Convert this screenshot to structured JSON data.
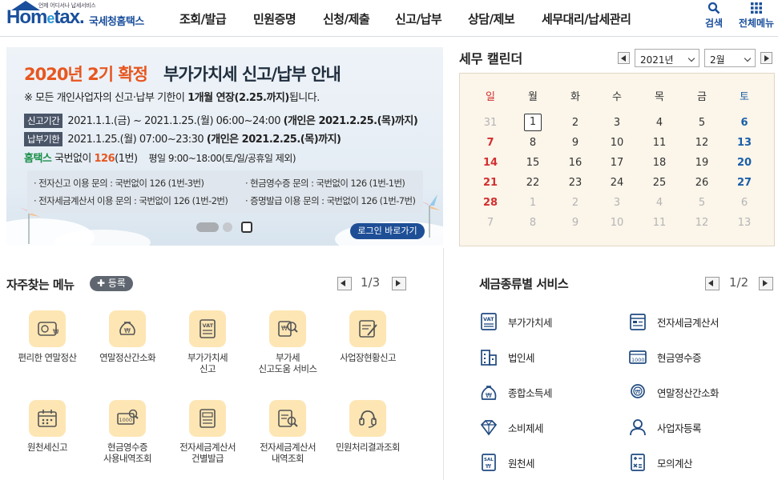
{
  "header": {
    "logo_small": "언제 어디서나 납세서비스",
    "logo_main_a": "Hom",
    "logo_main_e": "e",
    "logo_main_b": "tax.",
    "logo_kr": "국세청홈택스",
    "nav": [
      "조회/발급",
      "민원증명",
      "신청/제출",
      "신고/납부",
      "상담/제보",
      "세무대리/납세관리"
    ],
    "search_label": "검색",
    "all_menu_label": "전체메뉴"
  },
  "banner": {
    "title_highlight": "2020년 2기 확정",
    "title_rest": "부가가치세 신고/납부 안내",
    "note_pre": "※ 모든 개인사업자의 신고·납부 기한이 ",
    "note_bold": "1개월 연장(2.25.까지)",
    "note_post": "됩니다.",
    "row1_tag": "신고기간",
    "row1_text": "2021.1.1.(금) ~ 2021.1.25.(월) 06:00~24:00 ",
    "row1_bold": "(개인은 2021.2.25.(목)까지)",
    "row2_tag": "납부기한",
    "row2_text": "2021.1.25.(월) 07:00~23:30 ",
    "row2_bold": "(개인은 2021.2.25.(목)까지)",
    "hometax_label": "홈택스",
    "hometax_mid": " 국번없이 ",
    "hometax_num": "126",
    "hometax_tail": "(1번)",
    "hours": "평일 9:00~18:00(토/일/공휴일 제외)",
    "info": [
      "· 전자신고 이용 문의 : 국번없이 126 (1번-3번)",
      "· 현금영수증 문의 : 국번없이 126 (1번-1번)",
      "· 전자세금계산서 이용 문의 : 국번없이 126 (1번-2번)",
      "· 증명발급 이용 문의 : 국번없이 126 (1번-7번)"
    ],
    "login_button": "로그인 바로가기"
  },
  "calendar": {
    "title": "세무 캘린더",
    "year": "2021년",
    "month": "2월",
    "weekdays": [
      "일",
      "월",
      "화",
      "수",
      "목",
      "금",
      "토"
    ],
    "weeks": [
      [
        "31",
        "1",
        "2",
        "3",
        "4",
        "5",
        "6"
      ],
      [
        "7",
        "8",
        "9",
        "10",
        "11",
        "12",
        "13"
      ],
      [
        "14",
        "15",
        "16",
        "17",
        "18",
        "19",
        "20"
      ],
      [
        "21",
        "22",
        "23",
        "24",
        "25",
        "26",
        "27"
      ],
      [
        "28",
        "1",
        "2",
        "3",
        "4",
        "5",
        "6"
      ],
      [
        "7",
        "8",
        "9",
        "10",
        "11",
        "12",
        "13"
      ]
    ]
  },
  "favorites": {
    "title": "자주찾는 메뉴",
    "register_label": "등록",
    "page_current": "1",
    "page_total": "/3",
    "items": [
      {
        "label": "편리한 연말정산",
        "icon": "calculator-coin-icon"
      },
      {
        "label": "연말정산간소화",
        "icon": "money-bag-icon"
      },
      {
        "label": "부가가치세\n신고",
        "icon": "vat-document-icon"
      },
      {
        "label": "부가세\n신고도움 서비스",
        "icon": "magnifier-document-icon"
      },
      {
        "label": "사업장현황신고",
        "icon": "report-pen-icon"
      },
      {
        "label": "원천세신고",
        "icon": "calendar-icon"
      },
      {
        "label": "현금영수증\n사용내역조회",
        "icon": "cash-receipt-icon"
      },
      {
        "label": "전자세금계산서\n건별발급",
        "icon": "invoice-icon"
      },
      {
        "label": "전자세금계산서\n내역조회",
        "icon": "invoice-search-icon"
      },
      {
        "label": "민원처리결과조회",
        "icon": "headset-icon"
      }
    ]
  },
  "tax_services": {
    "title": "세금종류별 서비스",
    "page_current": "1",
    "page_total": "/2",
    "items": [
      {
        "label": "부가가치세",
        "icon": "vat-icon"
      },
      {
        "label": "전자세금계산서",
        "icon": "electronic-invoice-icon"
      },
      {
        "label": "법인세",
        "icon": "building-icon"
      },
      {
        "label": "현금영수증",
        "icon": "cash-1000-icon"
      },
      {
        "label": "종합소득세",
        "icon": "money-bag-won-icon"
      },
      {
        "label": "연말정산간소화",
        "icon": "coin-hand-icon"
      },
      {
        "label": "소비제세",
        "icon": "diamond-icon"
      },
      {
        "label": "사업자등록",
        "icon": "person-icon"
      },
      {
        "label": "원천세",
        "icon": "salary-slip-icon"
      },
      {
        "label": "모의계산",
        "icon": "calculator-icon"
      }
    ]
  },
  "colors": {
    "brand": "#1a4f9c",
    "accent_orange": "#e8561f",
    "sunday": "#d32f2f",
    "saturday": "#1a5fa8"
  }
}
